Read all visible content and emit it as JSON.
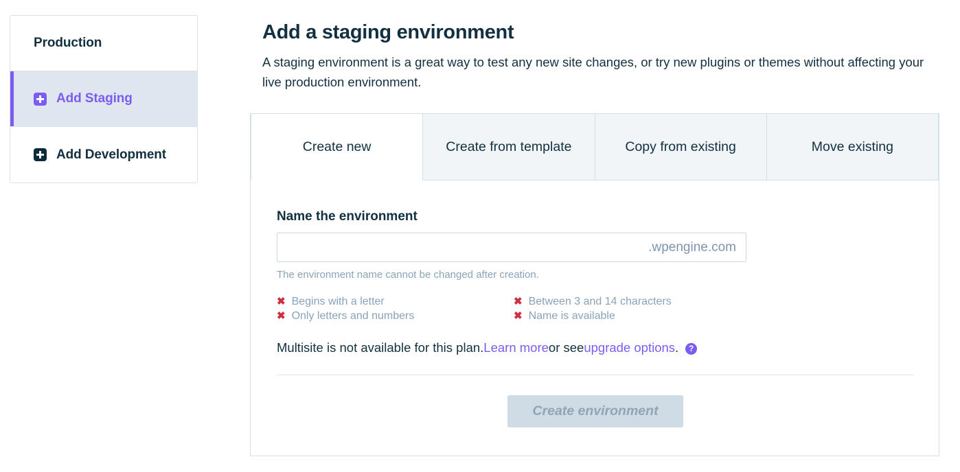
{
  "sidebar": {
    "items": [
      {
        "label": "Production",
        "icon": null,
        "state": "plain"
      },
      {
        "label": "Add Staging",
        "icon": "plus-square-icon",
        "state": "active"
      },
      {
        "label": "Add Development",
        "icon": "plus-square-icon",
        "state": "plain"
      }
    ]
  },
  "header": {
    "title": "Add a staging environment",
    "description": "A staging environment is a great way to test any new site changes, or try new plugins or themes without affecting your live production environment."
  },
  "tabs": [
    {
      "label": "Create new",
      "active": true
    },
    {
      "label": "Create from template",
      "active": false
    },
    {
      "label": "Copy from existing",
      "active": false
    },
    {
      "label": "Move existing",
      "active": false
    }
  ],
  "form": {
    "field_label": "Name the environment",
    "name_value": "",
    "name_placeholder": "",
    "domain_suffix": ".wpengine.com",
    "helper_text": "The environment name cannot be changed after creation.",
    "rules": [
      {
        "text": "Begins with a letter",
        "mark": "✖",
        "status": "fail"
      },
      {
        "text": "Between 3 and 14 characters",
        "mark": "✖",
        "status": "fail"
      },
      {
        "text": "Only letters and numbers",
        "mark": "✖",
        "status": "fail"
      },
      {
        "text": "Name is available",
        "mark": "✖",
        "status": "fail"
      }
    ],
    "multisite": {
      "text_before": "Multisite is not available for this plan. ",
      "link1": "Learn more",
      "text_middle": " or see ",
      "link2": "upgrade options",
      "text_after": ".",
      "help_glyph": "?"
    },
    "submit_label": "Create environment"
  },
  "colors": {
    "accent_purple": "#7b5cf0",
    "dark_navy": "#12303f",
    "muted_blue": "#8aa3b8",
    "error_red": "#cf2e3f",
    "active_row_bg": "#dfe6ef",
    "tab_inactive_bg": "#f1f5f8",
    "disabled_btn_bg": "#cfdbe5"
  }
}
